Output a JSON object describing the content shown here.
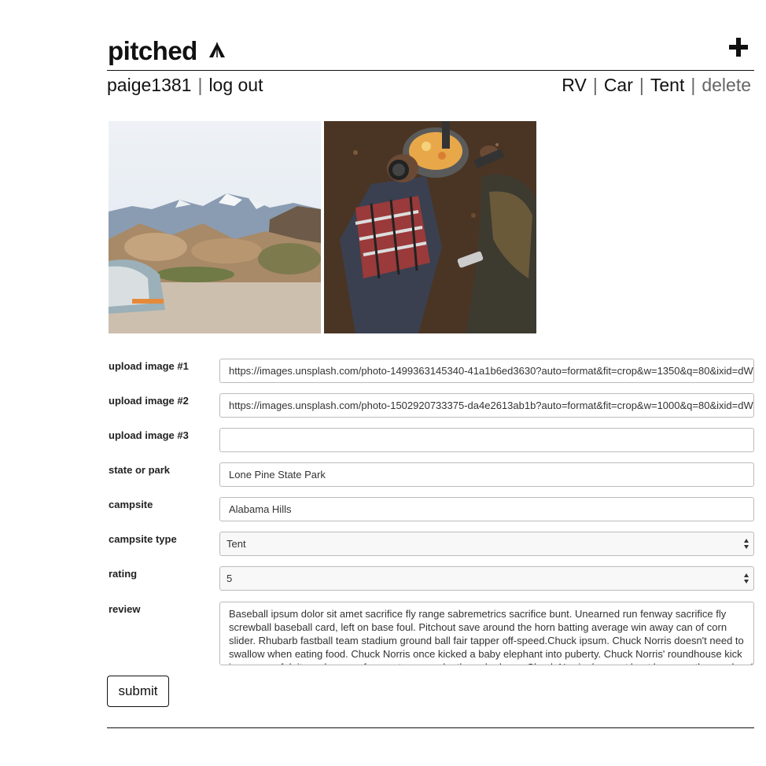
{
  "app": {
    "logo_text": "pitched",
    "logo_icon": "tent-icon",
    "add_icon": "plus-icon"
  },
  "user_nav": {
    "username": "paige1381",
    "separator": "|",
    "logout_label": "log out"
  },
  "filter_nav": {
    "items": [
      "RV",
      "Car",
      "Tent"
    ],
    "delete_label": "delete",
    "separator": "|"
  },
  "gallery": [
    {
      "alt": "campsite tent with mountains",
      "icon": "photo-mountains"
    },
    {
      "alt": "person cooking at camp",
      "icon": "photo-cooking"
    }
  ],
  "form": {
    "image1": {
      "label": "upload image #1",
      "value": "https://images.unsplash.com/photo-1499363145340-41a1b6ed3630?auto=format&fit=crop&w=1350&q=80&ixid=dW"
    },
    "image2": {
      "label": "upload image #2",
      "value": "https://images.unsplash.com/photo-1502920733375-da4e2613ab1b?auto=format&fit=crop&w=1000&q=80&ixid=dW"
    },
    "image3": {
      "label": "upload image #3",
      "value": ""
    },
    "state": {
      "label": "state or park",
      "value": "Lone Pine State Park"
    },
    "campsite": {
      "label": "campsite",
      "value": "Alabama Hills"
    },
    "type": {
      "label": "campsite type",
      "value": "Tent"
    },
    "rating": {
      "label": "rating",
      "value": "5"
    },
    "review": {
      "label": "review",
      "value": "Baseball ipsum dolor sit amet sacrifice fly range sabremetrics sacrifice bunt. Unearned run fenway sacrifice fly screwball baseball card, left on base foul. Pitchout save around the horn batting average win away can of corn slider. Rhubarb fastball team stadium ground ball fair tapper off-speed.Chuck ipsum. Chuck Norris doesn't need to swallow when eating food. Chuck Norris once kicked a baby elephant into puberty. Chuck Norris' roundhouse kick is so powerful, it can be seen from outer space by the naked eye. Chuck Norris does not hunt because the word"
    },
    "submit_label": "submit"
  },
  "colors": {
    "text": "#111111",
    "muted": "#666666",
    "border": "#bbbbbb"
  }
}
